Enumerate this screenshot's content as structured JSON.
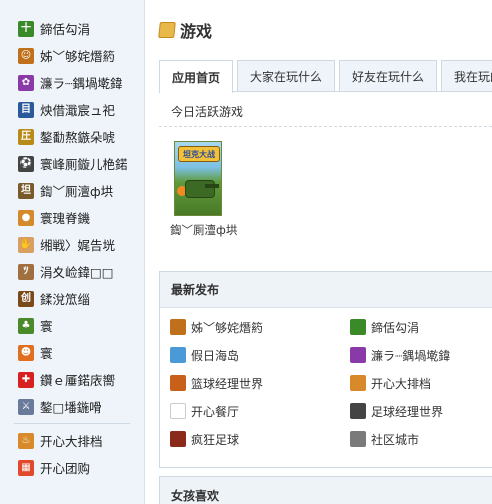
{
  "sidebar": {
    "items": [
      {
        "label": "鍗佸勾涓",
        "icon": "green-sprout-icon",
        "color": "#3a8a2a",
        "glyph": "十"
      },
      {
        "label": "姊﹀够姹熸箹",
        "icon": "game-character-icon",
        "color": "#c0701a",
        "glyph": "☺"
      },
      {
        "label": "濂ラ┈鍝堝墘鍏",
        "icon": "purple-flower-icon",
        "color": "#8a3aa8",
        "glyph": "✿"
      },
      {
        "label": "炴借濈宸ュ祀",
        "icon": "blue-book-icon",
        "color": "#2a5a9a",
        "glyph": "目"
      },
      {
        "label": "鏊勫熬鏃朵唬",
        "icon": "yellow-badge-icon",
        "color": "#b88a18",
        "glyph": "圧"
      },
      {
        "label": "寰峰厠鏇儿栬鍩",
        "icon": "soccer-ball-icon",
        "color": "#444444",
        "glyph": "⚽"
      },
      {
        "label": "鍧﹀厠澶ф垬",
        "icon": "tank-game-icon",
        "color": "#7a5a2a",
        "glyph": "坦"
      },
      {
        "label": "寰瑰脊鐖",
        "icon": "bubble-icon",
        "color": "#d48a2a",
        "glyph": "●"
      },
      {
        "label": "缃戦〉娓告垙",
        "icon": "hand-icon",
        "color": "#d8a060",
        "glyph": "✋"
      },
      {
        "label": "涓夊崄鍏□□",
        "icon": "cat-icon",
        "color": "#a07040",
        "glyph": "ﾂ"
      },
      {
        "label": "鍒涗笟缁",
        "icon": "create-icon",
        "color": "#7a4a1a",
        "glyph": "创"
      },
      {
        "label": "寰",
        "icon": "seedling-icon",
        "color": "#4a8a2a",
        "glyph": "♣"
      },
      {
        "label": "寰",
        "icon": "cute-face-icon",
        "color": "#e07020",
        "glyph": "☻"
      },
      {
        "label": "鑽ｅ厜鍩庡嚮",
        "icon": "red-cross-icon",
        "color": "#d82020",
        "glyph": "✚"
      },
      {
        "label": "鏊□墦鍦嗗",
        "icon": "swords-icon",
        "color": "#6a7a9a",
        "glyph": "⚔"
      }
    ],
    "bottom_items": [
      {
        "label": "开心大排档",
        "icon": "happy-food-stall-icon",
        "color": "#d88a2a",
        "glyph": "♨"
      },
      {
        "label": "开心团购",
        "icon": "group-buy-icon",
        "color": "#e04a2a",
        "glyph": "▦"
      }
    ]
  },
  "header": {
    "title": "游戏",
    "icon": "game-box-icon"
  },
  "tabs": [
    {
      "label": "应用首页",
      "active": true
    },
    {
      "label": "大家在玩什么",
      "active": false
    },
    {
      "label": "好友在玩什么",
      "active": false
    },
    {
      "label": "我在玩的",
      "active": false
    }
  ],
  "today": {
    "heading": "今日活跃游戏",
    "game": {
      "thumb_logo": "坦克大战",
      "caption": "鍧﹀厠澶ф垬"
    }
  },
  "latest": {
    "heading": "最新发布",
    "items": [
      {
        "label": "姊﹀够姹熸箹",
        "icon": "game-character-icon",
        "color": "#c0701a"
      },
      {
        "label": "鍗佸勾涓",
        "icon": "green-sprout-icon",
        "color": "#3a8a2a"
      },
      {
        "label": "假日海岛",
        "icon": "island-icon",
        "color": "#4a9ad8"
      },
      {
        "label": "濂ラ┈鍝堝墘鍏",
        "icon": "purple-flower-icon",
        "color": "#8a3aa8"
      },
      {
        "label": "篮球经理世界",
        "icon": "basketball-icon",
        "color": "#c8601a"
      },
      {
        "label": "开心大排档",
        "icon": "happy-food-stall-icon",
        "color": "#d88a2a"
      },
      {
        "label": "开心餐厅",
        "icon": "restaurant-icon",
        "color": "#ffffff"
      },
      {
        "label": "足球经理世界",
        "icon": "soccer-ball-icon",
        "color": "#444444"
      },
      {
        "label": "疯狂足球",
        "icon": "crazy-soccer-icon",
        "color": "#8a2a1a"
      },
      {
        "label": "社区城市",
        "icon": "city-icon",
        "color": "#7a7a7a"
      }
    ]
  },
  "girls": {
    "heading": "女孩喜欢"
  }
}
